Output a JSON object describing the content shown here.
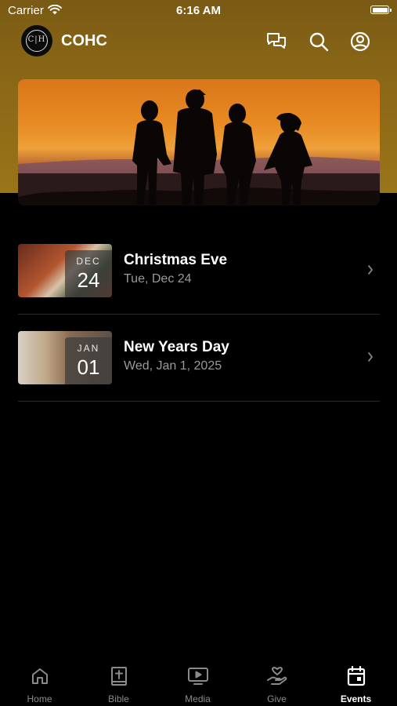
{
  "status_bar": {
    "carrier": "Carrier",
    "time": "6:16 AM"
  },
  "app_bar": {
    "logo_text": "C|H",
    "title": "COHC",
    "icons": [
      "chat-icon",
      "search-icon",
      "profile-icon"
    ]
  },
  "colors": {
    "header_gold": "#8a6717",
    "active_tab": "#ffffff",
    "inactive_tab": "#8a8a8a",
    "secondary_text": "#9a9a9a"
  },
  "events": [
    {
      "month": "DEC",
      "day": "24",
      "title": "Christmas Eve",
      "date": "Tue, Dec 24"
    },
    {
      "month": "JAN",
      "day": "01",
      "title": "New Years Day",
      "date": "Wed, Jan 1, 2025"
    }
  ],
  "tabs": [
    {
      "label": "Home",
      "icon": "home-icon"
    },
    {
      "label": "Bible",
      "icon": "bible-icon"
    },
    {
      "label": "Media",
      "icon": "media-icon"
    },
    {
      "label": "Give",
      "icon": "give-icon"
    },
    {
      "label": "Events",
      "icon": "events-icon",
      "active": true
    }
  ]
}
